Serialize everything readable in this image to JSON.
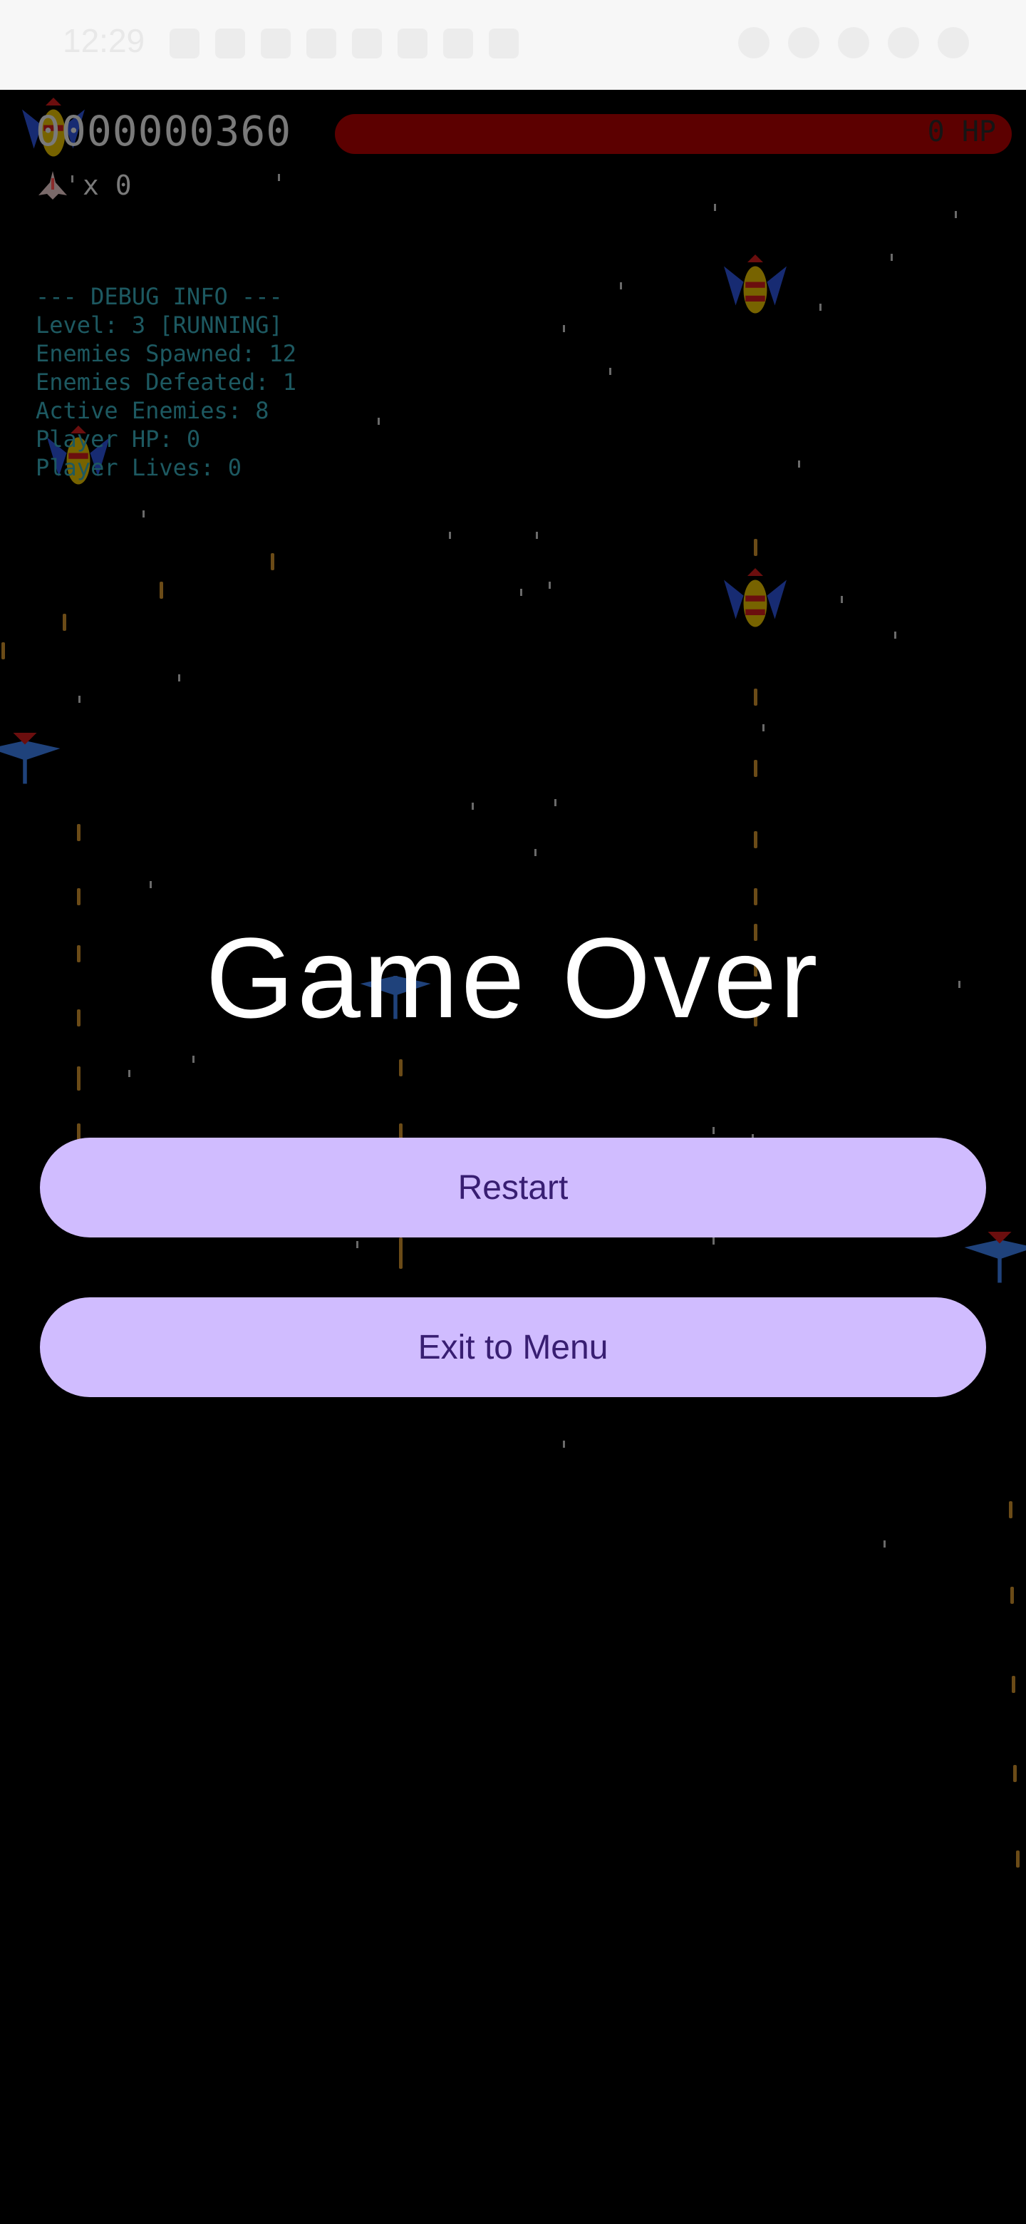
{
  "status_bar": {
    "time": "12:29"
  },
  "hud": {
    "score": "0000000360",
    "hp_label": "0 HP",
    "hp_fraction": 0,
    "lives_label": "x 0"
  },
  "debug": {
    "header": "--- DEBUG INFO ---",
    "level": "Level: 3 [RUNNING]",
    "enemies_spawned": "Enemies Spawned: 12",
    "enemies_defeated": "Enemies Defeated: 1",
    "active_enemies": "Active Enemies: 8",
    "player_hp": "Player HP: 0",
    "player_lives": "Player Lives: 0"
  },
  "overlay": {
    "title": "Game Over",
    "restart_label": "Restart",
    "exit_label": "Exit to Menu"
  },
  "colors": {
    "button_bg": "#d0bcff",
    "button_text": "#381e72",
    "hp_bar": "#5c0000",
    "debug_text": "#1d5961"
  }
}
